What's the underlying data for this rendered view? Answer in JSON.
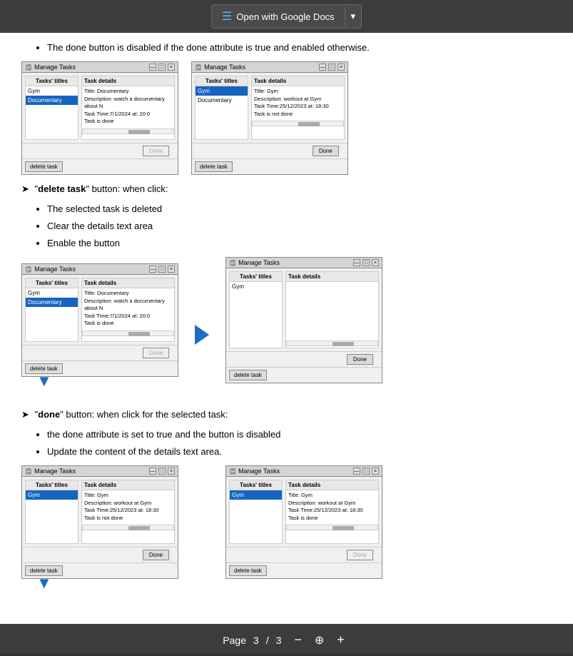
{
  "topbar": {
    "open_docs_label": "Open with Google Docs",
    "docs_icon": "☰",
    "arrow_icon": "▾"
  },
  "content": {
    "bullet_done_disabled": "The done button is disabled if the done attribute is true and enabled otherwise.",
    "delete_task_heading": "\"delete task\" button: when click:",
    "delete_bullets": [
      "The selected task is deleted",
      "Clear the details text area",
      "Enable the button"
    ],
    "done_button_heading": "\"done\" button: when click for the selected task:",
    "done_bullets": [
      "the done attribute is set to true and the button is disabled",
      "Update the content of the details text area."
    ]
  },
  "windows": {
    "title": "Manage Tasks",
    "tasks_title": "Tasks' titles",
    "details_title": "Task details",
    "window1_left": {
      "tasks": [
        "Gym",
        "Documentary"
      ],
      "selected": "Documentary",
      "details": "Title: Documentary\nDescription: watch a documentary about N\nTask Time:7/1/2024 at: 20:0\nTask is done",
      "done_label": "Done",
      "done_disabled": true,
      "delete_label": "delete task"
    },
    "window1_right": {
      "tasks": [
        "Gym",
        "Documentary"
      ],
      "selected": "Gym",
      "details": "Title: Gym\nDescription: workout at Gym\nTask Time:25/12/2023 at: 18:30\nTask is not done",
      "done_label": "Done",
      "done_disabled": false,
      "delete_label": "delete task"
    },
    "window2_left": {
      "tasks": [
        "Gym",
        "Documentary"
      ],
      "selected": "Documentary",
      "details": "Title: Documentary\nDescription: watch a documentary about N\nTask Time:7/1/2024 at: 20:0\nTask is done",
      "done_label": "Done",
      "done_disabled": true,
      "delete_label": "delete task"
    },
    "window2_right": {
      "tasks": [
        "Gym"
      ],
      "selected": "",
      "details": "",
      "done_label": "Done",
      "done_disabled": false,
      "delete_label": "delete task"
    },
    "window3_left": {
      "tasks": [
        "Gym"
      ],
      "selected": "Gym",
      "details": "Title: Gym\nDescription: workout at Gym\nTask Time:25/12/2023 at: 18:30\nTask is not done",
      "done_label": "Done",
      "done_disabled": false,
      "delete_label": "delete task"
    },
    "window3_right": {
      "tasks": [
        "Gym"
      ],
      "selected": "Gym",
      "details": "Title: Gym\nDescription: workout at Gym\nTask Time:25/12/2023 at: 18:30\nTask is done",
      "done_label": "Done",
      "done_disabled": true,
      "delete_label": "delete task"
    }
  },
  "pagebar": {
    "page_label": "Page",
    "current": "3",
    "separator": "/",
    "total": "3",
    "minus_icon": "−",
    "zoom_icon": "⊕",
    "plus_icon": "+"
  }
}
